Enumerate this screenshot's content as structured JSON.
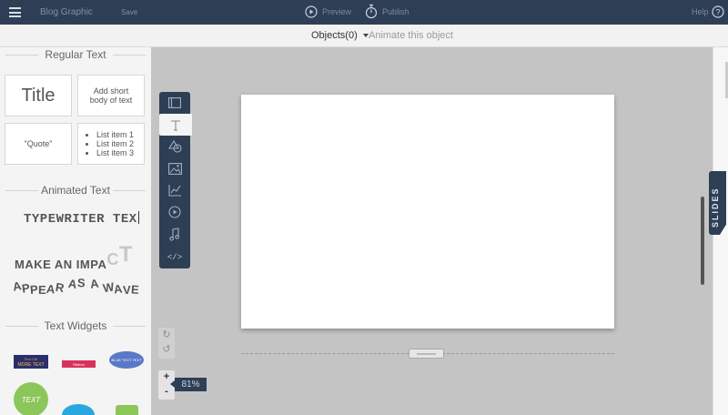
{
  "app": {
    "doc_title": "Blog Graphic",
    "save_label": "Save",
    "preview_label": "Preview",
    "publish_label": "Publish",
    "help_label": "Help",
    "help_icon": "?"
  },
  "subbar": {
    "objects_label": "Objects(0)",
    "animate_label": "Animate this object"
  },
  "left_panel": {
    "regular_text": {
      "heading": "Regular Text",
      "title_card": "Title",
      "body_card": "Add short body of text",
      "quote_card": "\"Quote\"",
      "list_items": [
        "List item 1",
        "List item 2",
        "List item 3"
      ]
    },
    "animated_text": {
      "heading": "Animated Text",
      "typewriter": "TYPEWRITER TEX",
      "impact_main": "MAKE AN IMPA",
      "impact_c": "C",
      "impact_t": "T",
      "wave_letters": [
        "A",
        "P",
        "P",
        "E",
        "A",
        "R",
        " ",
        "A",
        "S",
        " ",
        "A",
        " ",
        "W",
        "A",
        "V",
        "E"
      ]
    },
    "text_widgets": {
      "heading": "Text Widgets",
      "widget_1_top": "Text Ctrl",
      "widget_1_main": "MORE TEXT",
      "widget_2": "Ribbon",
      "widget_3": "BLUE TEXT TEXT",
      "widget_4": "TEXT"
    }
  },
  "toolbar": {
    "code_label": "</>"
  },
  "canvas": {
    "zoom_in": "+",
    "zoom_out": "-",
    "zoom_level": "81%"
  },
  "right": {
    "slides_label": "SLIDES"
  },
  "colors": {
    "topbar": "#2e3f55",
    "workspace": "#c4c4c4",
    "panel": "#f4f4f4",
    "widget_navy": "#2a2f6b",
    "widget_pink": "#d9335b",
    "widget_blue": "#5a78c8",
    "widget_green": "#8cc65a",
    "widget_cyan": "#2aa7df"
  }
}
